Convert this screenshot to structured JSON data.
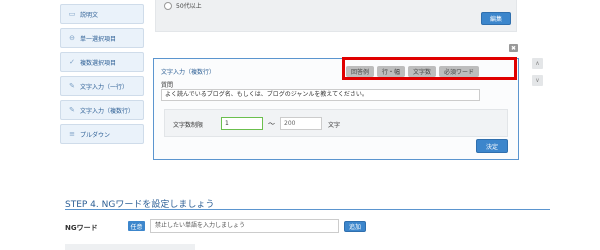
{
  "sidebar": {
    "items": [
      {
        "label": "説明文",
        "icon": "comment-icon",
        "glyph": "▭"
      },
      {
        "label": "単一選択項目",
        "icon": "minus-circle-icon",
        "glyph": "⊖"
      },
      {
        "label": "複数選択項目",
        "icon": "check-icon",
        "glyph": "✓"
      },
      {
        "label": "文字入力（一行）",
        "icon": "pencil-icon",
        "glyph": "✎"
      },
      {
        "label": "文字入力（複数行）",
        "icon": "pencil-icon",
        "glyph": "✎"
      },
      {
        "label": "プルダウン",
        "icon": "list-icon",
        "glyph": "≡"
      }
    ]
  },
  "top_panel": {
    "radio_label": "50代以上",
    "edit_label": "編集"
  },
  "close_glyph": "✖",
  "card": {
    "title": "文字入力（複数行）",
    "tools": [
      "回答例",
      "行・幅",
      "文字数",
      "必須ワード"
    ],
    "question_label": "質問",
    "question_value": "よく読んでいるブログ名、もしくは、ブログのジャンルを教えてください。",
    "limit_label": "文字数制限",
    "limit_min": "1",
    "limit_tilde": "〜",
    "limit_max": "200",
    "limit_unit": "文字",
    "ok_label": "決定"
  },
  "arrows": {
    "up": "∧",
    "down": "∨"
  },
  "step": {
    "title": "STEP 4. NGワードを設定しましょう",
    "ng_label": "NGワード",
    "badge": "任意",
    "ng_placeholder": "禁止したい単語を入力しましょう",
    "add_label": "追加"
  },
  "colors": {
    "accent": "#3c86cc",
    "highlight": "#e00000",
    "card_border": "#5b95cf"
  }
}
